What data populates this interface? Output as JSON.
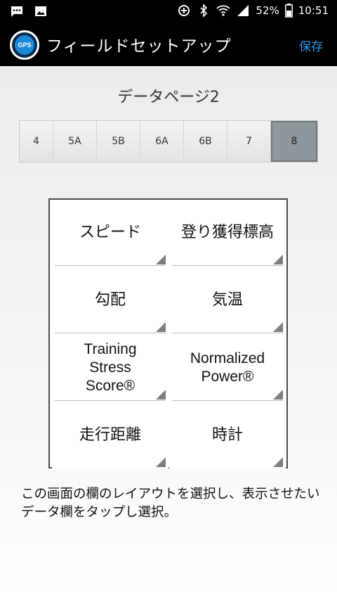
{
  "status_bar": {
    "battery": "52%",
    "time": "10:51"
  },
  "header": {
    "logo_text": "GPS",
    "title": "フィールドセットアップ",
    "save_label": "保存"
  },
  "page_title": "データページ2",
  "tabs": [
    {
      "label": "4",
      "active": false
    },
    {
      "label": "5A",
      "active": false
    },
    {
      "label": "5B",
      "active": false
    },
    {
      "label": "6A",
      "active": false
    },
    {
      "label": "6B",
      "active": false
    },
    {
      "label": "7",
      "active": false
    },
    {
      "label": "8",
      "active": true
    }
  ],
  "fields": [
    {
      "label": "スピード"
    },
    {
      "label": "登り獲得標高"
    },
    {
      "label": "勾配"
    },
    {
      "label": "気温"
    },
    {
      "label": "Training\nStress\nScore®"
    },
    {
      "label": "Normalized\nPower®"
    },
    {
      "label": "走行距離"
    },
    {
      "label": "時計"
    }
  ],
  "instruction": "この画面の欄のレイアウトを選択し、表示させたいデータ欄をタップし選択。"
}
